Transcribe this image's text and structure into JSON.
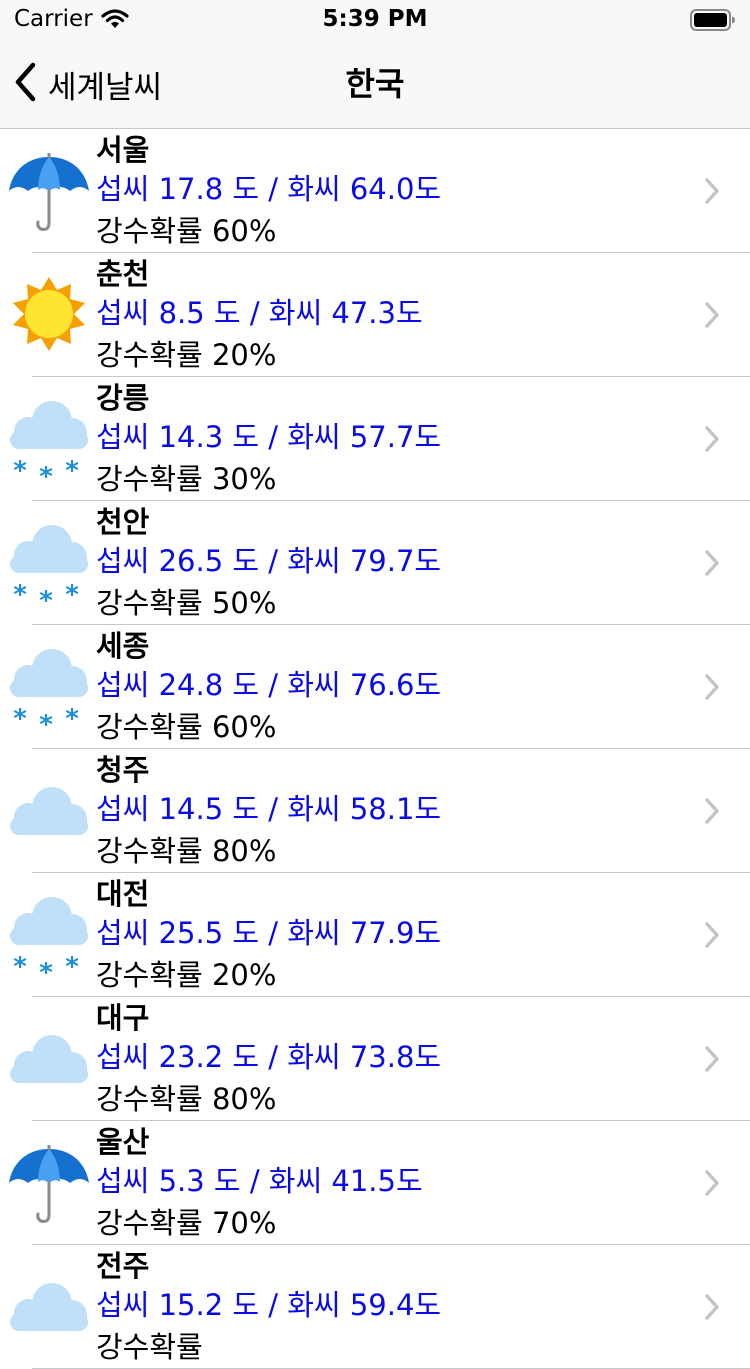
{
  "status": {
    "carrier": "Carrier",
    "time": "5:39 PM"
  },
  "nav": {
    "back_label": "세계날씨",
    "title": "한국"
  },
  "cities": [
    {
      "name": "서울",
      "temp": "섭씨 17.8 도 / 화씨 64.0도",
      "rain": "강수확률 60%",
      "icon": "umbrella-icon"
    },
    {
      "name": "춘천",
      "temp": "섭씨 8.5 도 / 화씨 47.3도",
      "rain": "강수확률 20%",
      "icon": "sun-icon"
    },
    {
      "name": "강릉",
      "temp": "섭씨 14.3 도 / 화씨 57.7도",
      "rain": "강수확률 30%",
      "icon": "snow-cloud-icon"
    },
    {
      "name": "천안",
      "temp": "섭씨 26.5 도 / 화씨 79.7도",
      "rain": "강수확률 50%",
      "icon": "snow-cloud-icon"
    },
    {
      "name": "세종",
      "temp": "섭씨 24.8 도 / 화씨 76.6도",
      "rain": "강수확률 60%",
      "icon": "snow-cloud-icon"
    },
    {
      "name": "청주",
      "temp": "섭씨 14.5 도 / 화씨 58.1도",
      "rain": "강수확률 80%",
      "icon": "cloud-icon"
    },
    {
      "name": "대전",
      "temp": "섭씨 25.5 도 / 화씨 77.9도",
      "rain": "강수확률 20%",
      "icon": "snow-cloud-icon"
    },
    {
      "name": "대구",
      "temp": "섭씨 23.2 도 / 화씨 73.8도",
      "rain": "강수확률 80%",
      "icon": "cloud-icon"
    },
    {
      "name": "울산",
      "temp": "섭씨 5.3 도 / 화씨 41.5도",
      "rain": "강수확률 70%",
      "icon": "umbrella-icon"
    },
    {
      "name": "전주",
      "temp": "섭씨 15.2 도 / 화씨 59.4도",
      "rain": "강수확률",
      "icon": "cloud-icon"
    }
  ],
  "colors": {
    "temp_text": "#0a0ae6",
    "chevron": "#c4c4c8",
    "cloud": "#bfe0f8",
    "snowflake": "#1a8fe0",
    "sun": "#f6a000",
    "umbrella": "#1570d0"
  }
}
